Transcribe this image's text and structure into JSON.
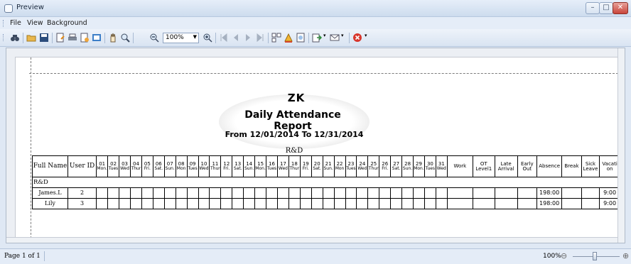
{
  "window": {
    "title": "Preview",
    "controls": {
      "minimize": "–",
      "maximize": "□",
      "close": "✕"
    }
  },
  "menu": [
    "File",
    "View",
    "Background"
  ],
  "toolbar": {
    "zoom_value": "100%",
    "icons": [
      "find-icon",
      "open-icon",
      "save-icon",
      "page-setup-icon",
      "print-icon",
      "quick-print-icon",
      "export-icon",
      "hand-tool-icon",
      "magnifier-icon",
      "zoom-out-icon",
      "zoom-in-icon",
      "first-page-icon",
      "previous-page-icon",
      "next-page-icon",
      "last-page-icon",
      "multiple-pages-icon",
      "color-icon",
      "watermark-icon",
      "export-document-icon",
      "send-email-icon",
      "close-preview-icon"
    ]
  },
  "report": {
    "company": "ZK",
    "title": "Daily Attendance Report",
    "date_range": "From 12/01/2014 To 12/31/2014",
    "department": "R&D",
    "headers": {
      "full_name": "Full Name",
      "user_id": "User ID",
      "work": "Work",
      "ot_level": "OT Level1",
      "late_arrival": "Late Arrival",
      "early_out": "Early Out",
      "absence": "Absence",
      "break": "Break",
      "sick_leave": "Sick Leave",
      "vacation": "Vacati on"
    },
    "days": [
      {
        "num": "01",
        "wk": "Mon."
      },
      {
        "num": "02",
        "wk": "Tues"
      },
      {
        "num": "03",
        "wk": "Wed"
      },
      {
        "num": "04",
        "wk": "Thur"
      },
      {
        "num": "05",
        "wk": "Fri."
      },
      {
        "num": "06",
        "wk": "Sat."
      },
      {
        "num": "07",
        "wk": "Sun."
      },
      {
        "num": "08",
        "wk": "Mon"
      },
      {
        "num": "09",
        "wk": "Tues"
      },
      {
        "num": "10",
        "wk": "Wed"
      },
      {
        "num": "11",
        "wk": "Thur"
      },
      {
        "num": "12",
        "wk": "Fri."
      },
      {
        "num": "13",
        "wk": "Sat."
      },
      {
        "num": "14",
        "wk": "Sun."
      },
      {
        "num": "15",
        "wk": "Mon."
      },
      {
        "num": "16",
        "wk": "Tues"
      },
      {
        "num": "17",
        "wk": "Wed"
      },
      {
        "num": "18",
        "wk": "Thur"
      },
      {
        "num": "19",
        "wk": "Fri."
      },
      {
        "num": "20",
        "wk": "Sat."
      },
      {
        "num": "21",
        "wk": "Sun."
      },
      {
        "num": "22",
        "wk": "Mon"
      },
      {
        "num": "23",
        "wk": "Tues"
      },
      {
        "num": "24",
        "wk": "Wed"
      },
      {
        "num": "25",
        "wk": "Thur"
      },
      {
        "num": "26",
        "wk": "Fri."
      },
      {
        "num": "27",
        "wk": "Sat."
      },
      {
        "num": "28",
        "wk": "Sun."
      },
      {
        "num": "29",
        "wk": "Mon."
      },
      {
        "num": "30",
        "wk": "Tues"
      },
      {
        "num": "31",
        "wk": "Wed"
      }
    ],
    "group_label": "R&D",
    "rows": [
      {
        "name": "James.L",
        "id": "2",
        "absence": "198:00",
        "vacation": "9:00"
      },
      {
        "name": "Lily",
        "id": "3",
        "absence": "198:00",
        "vacation": "9:00"
      }
    ]
  },
  "status": {
    "page": "Page 1 of 1",
    "zoom": "100%",
    "zoom_level_percent": 100
  },
  "colors": {
    "chrome": "#dfe8f4",
    "close": "#c8453a",
    "paper": "#ffffff"
  }
}
